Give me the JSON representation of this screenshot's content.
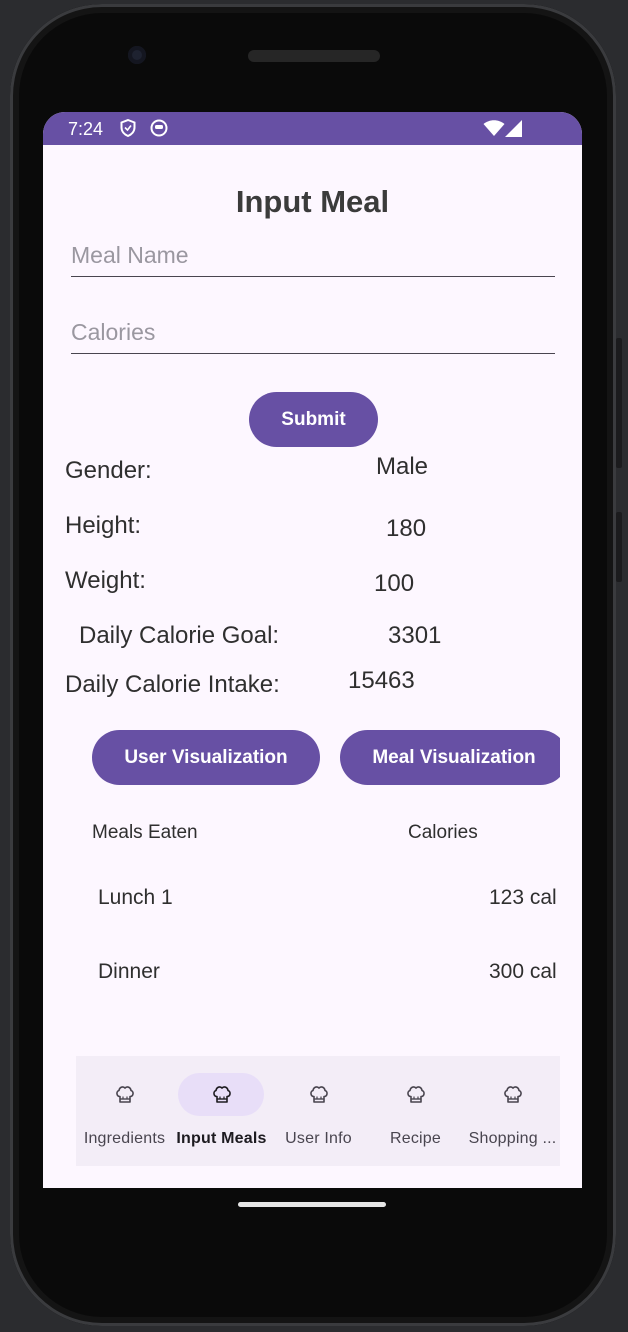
{
  "status_bar": {
    "time": "7:24"
  },
  "page_title": "Input Meal",
  "meal_name_field": {
    "placeholder": "Meal Name",
    "value": ""
  },
  "calories_field": {
    "placeholder": "Calories",
    "value": ""
  },
  "submit_label": "Submit",
  "user_info": [
    {
      "label": "Gender:",
      "value": "Male"
    },
    {
      "label": "Height:",
      "value": "180"
    },
    {
      "label": "Weight:",
      "value": "100"
    },
    {
      "label": "Daily Calorie Goal:",
      "value": "3301"
    },
    {
      "label": "Daily Calorie Intake:",
      "value": "15463"
    }
  ],
  "buttons": {
    "user_visualization": "User Visualization",
    "meal_visualization": "Meal Visualization"
  },
  "meals_table": {
    "headers": [
      "Meals Eaten",
      "Calories"
    ],
    "rows": [
      {
        "meal": "Lunch 1",
        "calories": "123 cal"
      },
      {
        "meal": "Dinner",
        "calories": "300 cal"
      }
    ]
  },
  "bottom_nav": {
    "items": [
      {
        "label": "Ingredients",
        "icon": "chef-hat-icon"
      },
      {
        "label": "Input Meals",
        "icon": "chef-hat-icon",
        "selected": true
      },
      {
        "label": "User Info",
        "icon": "chef-hat-icon"
      },
      {
        "label": "Recipe",
        "icon": "chef-hat-icon"
      },
      {
        "label": "Shopping ...",
        "icon": "chef-hat-icon"
      }
    ]
  },
  "colors": {
    "accent": "#6750a4",
    "background": "#fdf7ff",
    "nav_background": "#f3edf7",
    "nav_indicator": "#e8def8"
  }
}
